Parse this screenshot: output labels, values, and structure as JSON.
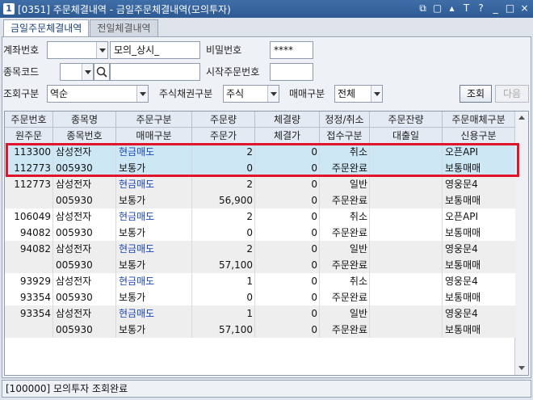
{
  "window": {
    "title": "[0351] 주문체결내역 - 금일주문체결내역(모의투자)",
    "ctrl_labels": [
      "⧉",
      "▢",
      "▴",
      "T",
      "?",
      "_",
      "□",
      "×"
    ]
  },
  "tabs": [
    {
      "label": "금일주문체결내역"
    },
    {
      "label": "전일체결내역"
    }
  ],
  "form": {
    "account_label": "계좌번호",
    "account_value": "",
    "account_name": "모의_상시_",
    "password_label": "비밀번호",
    "password_value": "****",
    "stock_label": "종목코드",
    "stock_value": "",
    "stock_name": "",
    "start_order_label": "시작주문번호",
    "start_order_value": "",
    "query_type_label": "조회구분",
    "query_type_value": "역순",
    "security_type_label": "주식채권구분",
    "security_type_value": "주식",
    "trade_type_label": "매매구분",
    "trade_type_value": "전체",
    "query_button": "조회",
    "next_button": "다음"
  },
  "grid": {
    "header_row1": [
      "주문번호",
      "종목명",
      "주문구분",
      "주문량",
      "체결량",
      "정정/취소",
      "주문잔량",
      "주문매체구분"
    ],
    "header_row2": [
      "원주문",
      "종목번호",
      "매매구분",
      "주문가",
      "체결가",
      "접수구분",
      "대출일",
      "신용구분"
    ],
    "rows": [
      {
        "a": [
          "113300",
          "삼성전자",
          "현금매도",
          "2",
          "0",
          "취소",
          "",
          "오픈API"
        ],
        "b": [
          "112773",
          "005930",
          "보통가",
          "0",
          "0",
          "주문완료",
          "",
          "보통매매"
        ]
      },
      {
        "a": [
          "112773",
          "삼성전자",
          "현금매도",
          "2",
          "0",
          "일반",
          "",
          "영웅문4"
        ],
        "b": [
          "",
          "005930",
          "보통가",
          "56,900",
          "0",
          "주문완료",
          "",
          "보통매매"
        ]
      },
      {
        "a": [
          "106049",
          "삼성전자",
          "현금매도",
          "2",
          "0",
          "취소",
          "",
          "오픈API"
        ],
        "b": [
          "94082",
          "005930",
          "보통가",
          "0",
          "0",
          "주문완료",
          "",
          "보통매매"
        ]
      },
      {
        "a": [
          "94082",
          "삼성전자",
          "현금매도",
          "2",
          "0",
          "일반",
          "",
          "영웅문4"
        ],
        "b": [
          "",
          "005930",
          "보통가",
          "57,100",
          "0",
          "주문완료",
          "",
          "보통매매"
        ]
      },
      {
        "a": [
          "93929",
          "삼성전자",
          "현금매도",
          "1",
          "0",
          "취소",
          "",
          "영웅문4"
        ],
        "b": [
          "93354",
          "005930",
          "보통가",
          "0",
          "0",
          "주문완료",
          "",
          "보통매매"
        ]
      },
      {
        "a": [
          "93354",
          "삼성전자",
          "현금매도",
          "1",
          "0",
          "일반",
          "",
          "영웅문4"
        ],
        "b": [
          "",
          "005930",
          "보통가",
          "57,100",
          "0",
          "주문완료",
          "",
          "보통매매"
        ]
      }
    ]
  },
  "status": {
    "text": "[100000] 모의투자 조회완료"
  },
  "colors": {
    "highlight": "#e0142b",
    "selected_row": "#cde8f4",
    "alt_row": "#eeeeee",
    "title_bar": "#2d5a93"
  }
}
